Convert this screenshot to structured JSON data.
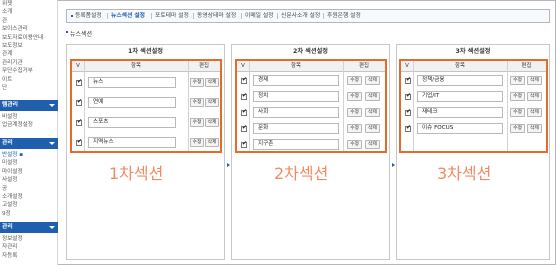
{
  "sidebar": {
    "top_items": [
      "위젯",
      "소개",
      "관",
      "보이스관리",
      "보도자료이용안내",
      "보도정보",
      "관계",
      "관리기관",
      "무단수집거부",
      "이트",
      "단"
    ],
    "group1": {
      "title": "템관리",
      "items": [
        "비설정",
        "업금계정설정"
      ]
    },
    "group2": {
      "title": "관리",
      "items": [
        "반설정 ▪",
        "미설정",
        "마이설정",
        "사설정",
        "공",
        "소개설정",
        "고설정",
        "9정"
      ]
    },
    "group3": {
      "title": "관리",
      "items": [
        "정보설정",
        "자관리",
        "자등록"
      ]
    }
  },
  "tabs": [
    {
      "label": "등록폼설정",
      "active": false
    },
    {
      "label": "뉴스섹션 설정",
      "active": true
    },
    {
      "label": "포토테마 설정",
      "active": false
    },
    {
      "label": "동영상테마 설정",
      "active": false
    },
    {
      "label": "이메일 설정",
      "active": false
    },
    {
      "label": "신문사소개 설정",
      "active": false
    },
    {
      "label": "후원은행 설정",
      "active": false
    }
  ],
  "section_title": "뉴스섹션",
  "panels": [
    {
      "title": "1차 섹션설정",
      "headers": {
        "v": "V",
        "item": "항목",
        "edit": "편집"
      },
      "rows": [
        {
          "value": "뉴스",
          "edit": "수정",
          "delete": "삭제"
        },
        {
          "value": "연예",
          "edit": "수정",
          "delete": "삭제"
        },
        {
          "value": "스포츠",
          "edit": "수정",
          "delete": "삭제"
        },
        {
          "value": "지역뉴스",
          "edit": "수정",
          "delete": "삭제"
        }
      ],
      "label": "1차섹션"
    },
    {
      "title": "2차 섹션설정",
      "headers": {
        "v": "V",
        "item": "항목",
        "edit": "편집"
      },
      "rows": [
        {
          "value": "경제",
          "edit": "수정",
          "delete": "삭제"
        },
        {
          "value": "정치",
          "edit": "수정",
          "delete": "삭제"
        },
        {
          "value": "사회",
          "edit": "수정",
          "delete": "삭제"
        },
        {
          "value": "문화",
          "edit": "수정",
          "delete": "삭제"
        },
        {
          "value": "지구촌",
          "edit": "수정",
          "delete": "삭제"
        }
      ],
      "label": "2차섹션"
    },
    {
      "title": "3차 섹션설정",
      "headers": {
        "v": "V",
        "item": "항목",
        "edit": "편집"
      },
      "rows": [
        {
          "value": "정책/금융",
          "edit": "수정",
          "delete": "삭제"
        },
        {
          "value": "기업/IT",
          "edit": "수정",
          "delete": "삭제"
        },
        {
          "value": "재테크",
          "edit": "수정",
          "delete": "삭제"
        },
        {
          "value": "이슈 FOCUS",
          "edit": "수정",
          "delete": "삭제"
        }
      ],
      "label": "3차섹션"
    }
  ],
  "colors": {
    "accent": "#1f5fae",
    "highlight_box": "#e36b2c",
    "label": "#f08c63"
  }
}
